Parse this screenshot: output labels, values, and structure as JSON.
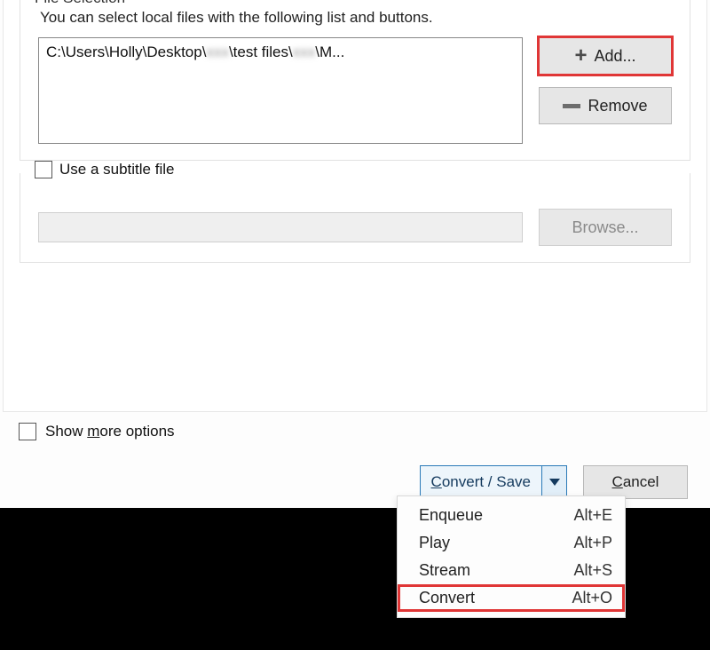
{
  "file_selection": {
    "legend": "File Selection",
    "help": "You can select local files with the following list and buttons.",
    "path_display_prefix": "C:\\Users\\Holly\\Desktop\\",
    "path_display_mid": "\\test files\\",
    "path_display_suffix": "\\M...",
    "redacted1": "xxx",
    "redacted2": "xxx",
    "add_label": "Add...",
    "remove_label": "Remove"
  },
  "subtitle": {
    "check_label": "Use a subtitle file",
    "browse_label": "Browse..."
  },
  "more_options": {
    "label_prefix": "Show ",
    "underline": "m",
    "label_suffix": "ore options"
  },
  "buttons": {
    "convert_save_prefix": "",
    "convert_save_u": "C",
    "convert_save_suffix": "onvert / Save",
    "cancel_u": "C",
    "cancel_suffix": "ancel"
  },
  "menu": {
    "items": [
      {
        "label": "Enqueue",
        "shortcut": "Alt+E"
      },
      {
        "label": "Play",
        "shortcut": "Alt+P"
      },
      {
        "label": "Stream",
        "shortcut": "Alt+S"
      },
      {
        "label": "Convert",
        "shortcut": "Alt+O"
      }
    ]
  }
}
